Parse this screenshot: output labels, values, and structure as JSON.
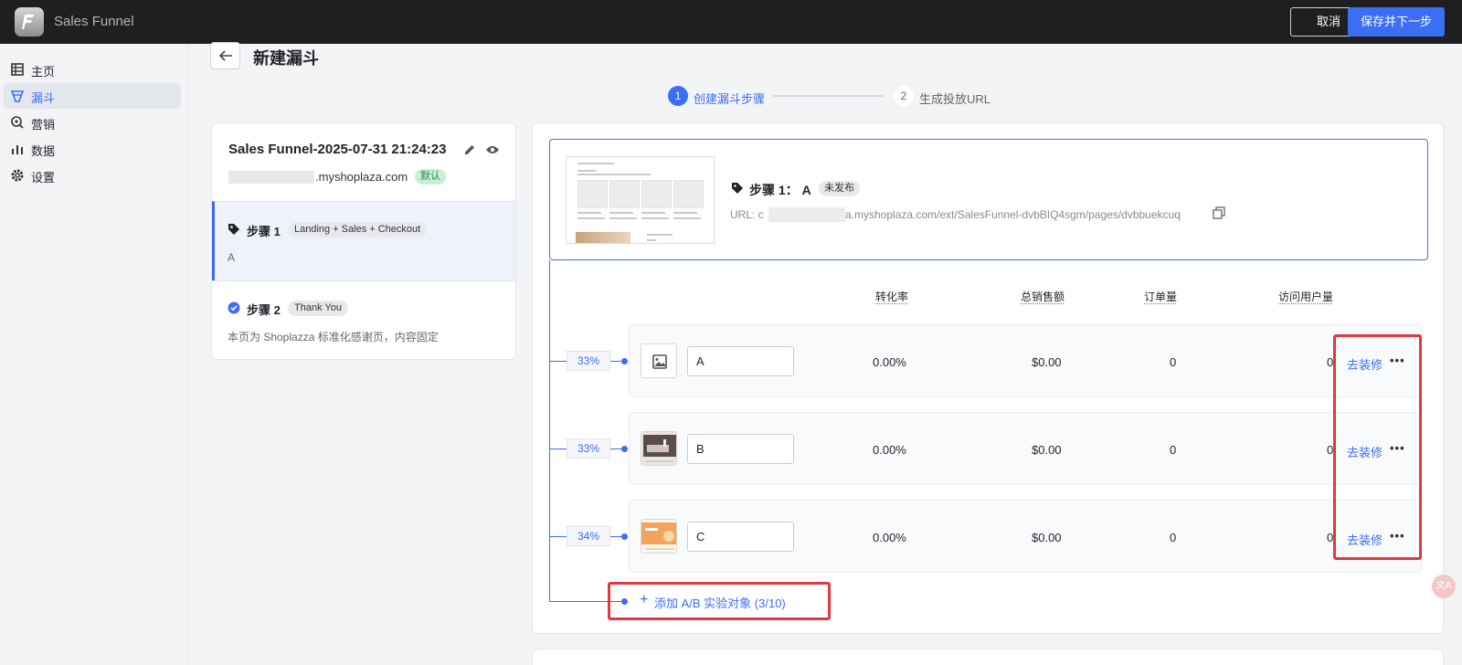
{
  "app": {
    "title": "Sales Funnel"
  },
  "header": {
    "cancel_label": "取消",
    "save_label": "保存并下一步"
  },
  "sidebar": {
    "items": [
      {
        "label": "主页",
        "icon": "table-icon"
      },
      {
        "label": "漏斗",
        "icon": "funnel-icon",
        "active": true
      },
      {
        "label": "营销",
        "icon": "marketing-icon"
      },
      {
        "label": "数据",
        "icon": "chart-icon"
      },
      {
        "label": "设置",
        "icon": "gear-icon"
      }
    ]
  },
  "page": {
    "title": "新建漏斗"
  },
  "stepper": [
    {
      "num": "1",
      "label": "创建漏斗步骤",
      "active": true
    },
    {
      "num": "2",
      "label": "生成投放URL",
      "active": false
    }
  ],
  "funnel": {
    "name": "Sales Funnel-2025-07-31 21:24:23",
    "domain": ".myshoplaza.com",
    "default_badge": "默认",
    "steps": [
      {
        "title": "步骤 1",
        "badge": "Landing + Sales + Checkout",
        "desc": "A"
      },
      {
        "title": "步骤 2",
        "badge": "Thank You",
        "desc": "本页为 Shoplazza 标准化感谢页，内容固定"
      }
    ]
  },
  "step_detail": {
    "title": "步骤 1： A",
    "status": "未发布",
    "url_label": "URL: c",
    "url": "a.myshoplaza.com/ext/SalesFunnel-dvbBIQ4sgm/pages/dvbbuekcuq"
  },
  "table": {
    "headers": [
      "转化率",
      "总销售额",
      "订单量",
      "访问用户量"
    ],
    "rows": [
      {
        "split": "33%",
        "name": "A",
        "conversion": "0.00%",
        "sales": "$0.00",
        "orders": "0",
        "visitors": "0",
        "action": "去装修",
        "more": "•••"
      },
      {
        "split": "33%",
        "name": "B",
        "conversion": "0.00%",
        "sales": "$0.00",
        "orders": "0",
        "visitors": "0",
        "action": "去装修",
        "more": "•••"
      },
      {
        "split": "34%",
        "name": "C",
        "conversion": "0.00%",
        "sales": "$0.00",
        "orders": "0",
        "visitors": "0",
        "action": "去装修",
        "more": "•••"
      }
    ]
  },
  "add_variant": {
    "label": "添加 A/B 实验对象 (3/10)"
  },
  "colors": {
    "accent": "#3b6ef5",
    "highlight": "#e0383c",
    "topbar": "#1f1f1f"
  }
}
